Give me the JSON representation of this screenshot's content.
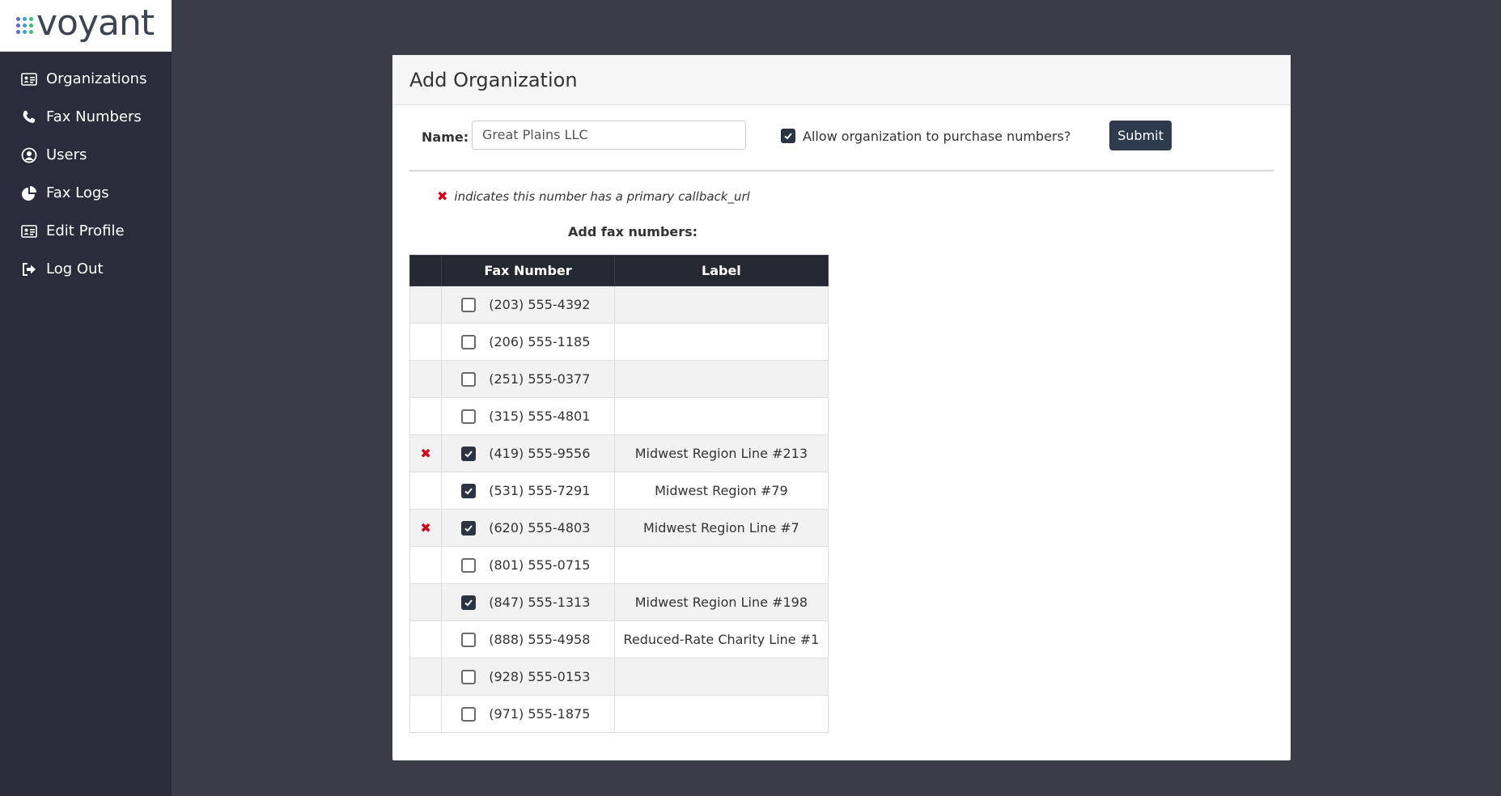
{
  "brand": {
    "logo_text": "voyant"
  },
  "sidebar": {
    "items": [
      {
        "label": "Organizations",
        "icon": "id-card-icon"
      },
      {
        "label": "Fax Numbers",
        "icon": "phone-icon"
      },
      {
        "label": "Users",
        "icon": "user-circle-icon"
      },
      {
        "label": "Fax Logs",
        "icon": "pie-chart-icon"
      },
      {
        "label": "Edit Profile",
        "icon": "id-card-icon"
      },
      {
        "label": "Log Out",
        "icon": "sign-out-icon"
      }
    ]
  },
  "card": {
    "title": "Add Organization"
  },
  "form": {
    "name_label": "Name:",
    "name_value": "Great Plains LLC",
    "allow_label": "Allow organization to purchase numbers?",
    "allow_checked": true,
    "submit_label": "Submit"
  },
  "legend": {
    "text": "indicates this number has a primary callback_url"
  },
  "table": {
    "title": "Add fax numbers:",
    "headers": [
      "",
      "Fax Number",
      "Label"
    ],
    "rows": [
      {
        "flag": false,
        "checked": false,
        "number": "(203) 555-4392",
        "label": ""
      },
      {
        "flag": false,
        "checked": false,
        "number": "(206) 555-1185",
        "label": ""
      },
      {
        "flag": false,
        "checked": false,
        "number": "(251) 555-0377",
        "label": ""
      },
      {
        "flag": false,
        "checked": false,
        "number": "(315) 555-4801",
        "label": ""
      },
      {
        "flag": true,
        "checked": true,
        "number": "(419) 555-9556",
        "label": "Midwest Region Line #213"
      },
      {
        "flag": false,
        "checked": true,
        "number": "(531) 555-7291",
        "label": "Midwest Region #79"
      },
      {
        "flag": true,
        "checked": true,
        "number": "(620) 555-4803",
        "label": "Midwest Region Line #7"
      },
      {
        "flag": false,
        "checked": false,
        "number": "(801) 555-0715",
        "label": ""
      },
      {
        "flag": false,
        "checked": true,
        "number": "(847) 555-1313",
        "label": "Midwest Region Line #198"
      },
      {
        "flag": false,
        "checked": false,
        "number": "(888) 555-4958",
        "label": "Reduced-Rate Charity Line #1"
      },
      {
        "flag": false,
        "checked": false,
        "number": "(928) 555-0153",
        "label": ""
      },
      {
        "flag": false,
        "checked": false,
        "number": "(971) 555-1875",
        "label": ""
      }
    ]
  },
  "colors": {
    "sidebar_bg": "#2c2b3c",
    "page_bg": "#3a3c47",
    "accent": "#2e3a4e",
    "flag": "#d0021b"
  }
}
